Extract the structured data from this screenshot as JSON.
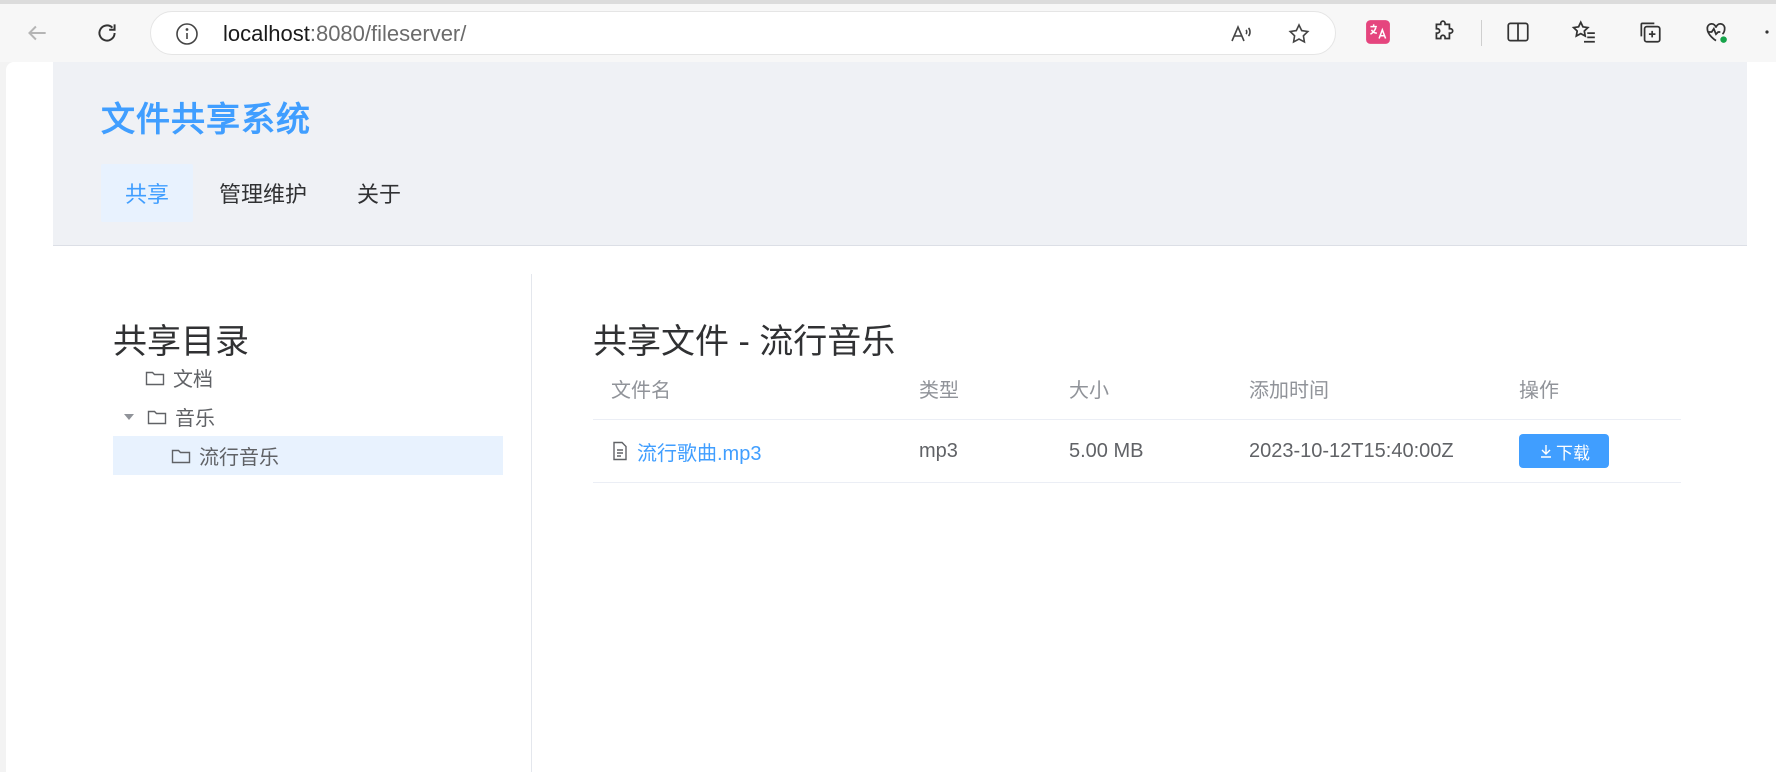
{
  "browser": {
    "url_host": "localhost",
    "url_rest": ":8080/fileserver/"
  },
  "header": {
    "title": "文件共享系统",
    "menu": [
      {
        "label": "共享",
        "active": true
      },
      {
        "label": "管理维护",
        "active": false
      },
      {
        "label": "关于",
        "active": false
      }
    ]
  },
  "sidebar": {
    "title": "共享目录",
    "tree": [
      {
        "label": "文档",
        "level": 1,
        "expanded": false,
        "has_children": false
      },
      {
        "label": "音乐",
        "level": 1,
        "expanded": true,
        "has_children": true
      },
      {
        "label": "流行音乐",
        "level": 2,
        "expanded": false,
        "has_children": false,
        "selected": true
      }
    ]
  },
  "main": {
    "title": "共享文件 - 流行音乐",
    "columns": [
      "文件名",
      "类型",
      "大小",
      "添加时间",
      "操作"
    ],
    "rows": [
      {
        "name": "流行歌曲.mp3",
        "type": "mp3",
        "size": "5.00 MB",
        "added": "2023-10-12T15:40:00Z",
        "action": "下载"
      }
    ]
  },
  "colors": {
    "accent": "#409eff",
    "header_bg": "#eff1f5",
    "selected_bg": "#e8f2fe"
  }
}
